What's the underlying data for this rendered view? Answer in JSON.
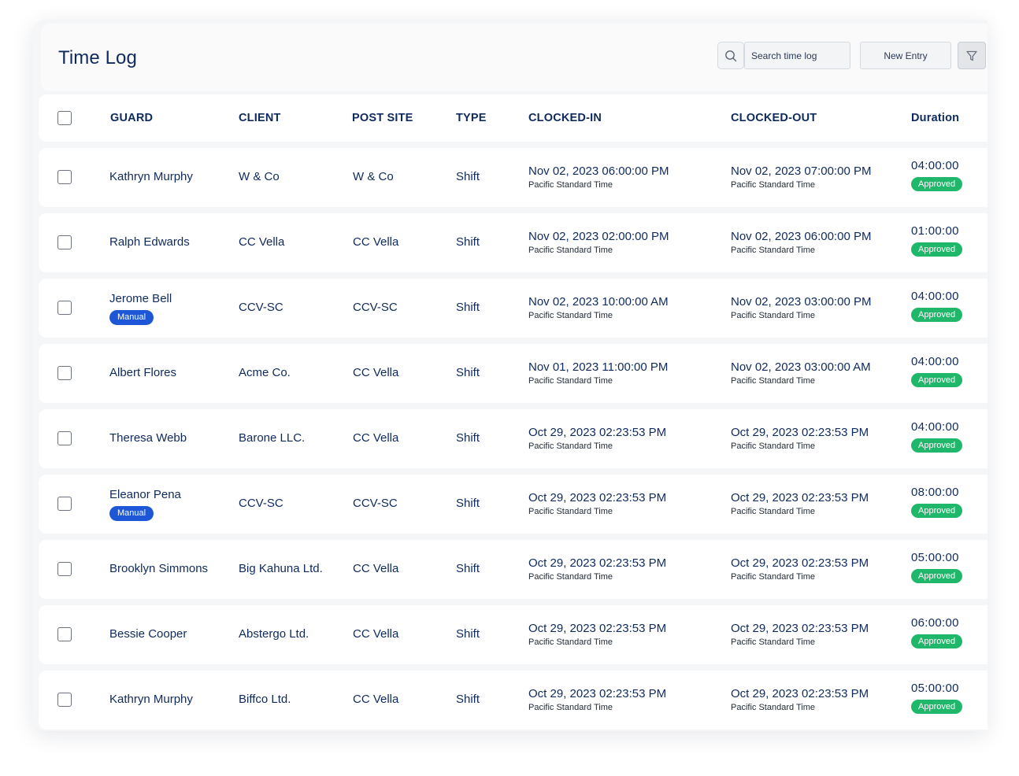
{
  "header": {
    "title": "Time Log",
    "search_placeholder": "Search time log",
    "new_entry_label": "New Entry"
  },
  "table": {
    "columns": [
      "GUARD",
      "CLIENT",
      "POST SITE",
      "TYPE",
      "CLOCKED-IN",
      "CLOCKED-OUT",
      "Duration"
    ],
    "rows": [
      {
        "guard": "Kathryn Murphy",
        "badge": "",
        "client": "W & Co",
        "post_site": "W & Co",
        "type": "Shift",
        "clocked_in": "Nov 02, 2023 06:00:00 PM",
        "clocked_in_tz": "Pacific Standard Time",
        "clocked_out": "Nov 02, 2023 07:00:00 PM",
        "clocked_out_tz": "Pacific Standard Time",
        "duration": "04:00:00",
        "status": "Approved"
      },
      {
        "guard": "Ralph Edwards",
        "badge": "",
        "client": "CC Vella",
        "post_site": "CC Vella",
        "type": "Shift",
        "clocked_in": "Nov 02, 2023 02:00:00 PM",
        "clocked_in_tz": "Pacific Standard Time",
        "clocked_out": "Nov 02, 2023 06:00:00 PM",
        "clocked_out_tz": "Pacific Standard Time",
        "duration": "01:00:00",
        "status": "Approved"
      },
      {
        "guard": "Jerome Bell",
        "badge": "Manual",
        "client": "CCV-SC",
        "post_site": "CCV-SC",
        "type": "Shift",
        "clocked_in": "Nov 02, 2023 10:00:00 AM",
        "clocked_in_tz": "Pacific Standard Time",
        "clocked_out": "Nov 02, 2023 03:00:00 PM",
        "clocked_out_tz": "Pacific Standard Time",
        "duration": "04:00:00",
        "status": "Approved"
      },
      {
        "guard": "Albert Flores",
        "badge": "",
        "client": "Acme Co.",
        "post_site": "CC Vella",
        "type": "Shift",
        "clocked_in": "Nov 01, 2023 11:00:00 PM",
        "clocked_in_tz": "Pacific Standard Time",
        "clocked_out": "Nov 02, 2023 03:00:00 AM",
        "clocked_out_tz": "Pacific Standard Time",
        "duration": "04:00:00",
        "status": "Approved"
      },
      {
        "guard": "Theresa Webb",
        "badge": "",
        "client": "Barone LLC.",
        "post_site": "CC Vella",
        "type": "Shift",
        "clocked_in": "Oct 29, 2023 02:23:53 PM",
        "clocked_in_tz": "Pacific Standard Time",
        "clocked_out": "Oct 29, 2023 02:23:53 PM",
        "clocked_out_tz": "Pacific Standard Time",
        "duration": "04:00:00",
        "status": "Approved"
      },
      {
        "guard": "Eleanor Pena",
        "badge": "Manual",
        "client": "CCV-SC",
        "post_site": "CCV-SC",
        "type": "Shift",
        "clocked_in": "Oct 29, 2023 02:23:53 PM",
        "clocked_in_tz": "Pacific Standard Time",
        "clocked_out": "Oct 29, 2023 02:23:53 PM",
        "clocked_out_tz": "Pacific Standard Time",
        "duration": "08:00:00",
        "status": "Approved"
      },
      {
        "guard": "Brooklyn Simmons",
        "badge": "",
        "client": "Big Kahuna Ltd.",
        "post_site": "CC Vella",
        "type": "Shift",
        "clocked_in": "Oct 29, 2023 02:23:53 PM",
        "clocked_in_tz": "Pacific Standard Time",
        "clocked_out": "Oct 29, 2023 02:23:53 PM",
        "clocked_out_tz": "Pacific Standard Time",
        "duration": "05:00:00",
        "status": "Approved"
      },
      {
        "guard": "Bessie Cooper",
        "badge": "",
        "client": "Abstergo Ltd.",
        "post_site": "CC Vella",
        "type": "Shift",
        "clocked_in": "Oct 29, 2023 02:23:53 PM",
        "clocked_in_tz": "Pacific Standard Time",
        "clocked_out": "Oct 29, 2023 02:23:53 PM",
        "clocked_out_tz": "Pacific Standard Time",
        "duration": "06:00:00",
        "status": "Approved"
      },
      {
        "guard": "Kathryn Murphy",
        "badge": "",
        "client": "Biffco Ltd.",
        "post_site": "CC Vella",
        "type": "Shift",
        "clocked_in": "Oct 29, 2023 02:23:53 PM",
        "clocked_in_tz": "Pacific Standard Time",
        "clocked_out": "Oct 29, 2023 02:23:53 PM",
        "clocked_out_tz": "Pacific Standard Time",
        "duration": "05:00:00",
        "status": "Approved"
      }
    ]
  },
  "icons": {
    "search": "search-icon",
    "filter": "filter-icon"
  },
  "colors": {
    "text": "#0f2a5c",
    "approved": "#1fb86a",
    "manual": "#1d56d6",
    "background": "#f5f6f8"
  }
}
